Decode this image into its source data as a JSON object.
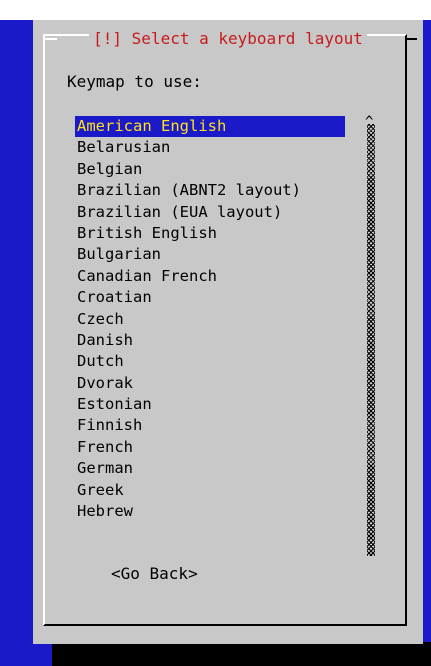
{
  "dialog": {
    "title": "[!] Select a keyboard layout",
    "prompt": "Keymap to use:",
    "scroll_arrow": "^",
    "go_back_label": "<Go Back>"
  },
  "keymaps": [
    "American English",
    "Belarusian",
    "Belgian",
    "Brazilian (ABNT2 layout)",
    "Brazilian (EUA layout)",
    "British English",
    "Bulgarian",
    "Canadian French",
    "Croatian",
    "Czech",
    "Danish",
    "Dutch",
    "Dvorak",
    "Estonian",
    "Finnish",
    "French",
    "German",
    "Greek",
    "Hebrew"
  ],
  "selected_keymap": "American English",
  "colors": {
    "screen_background": "#1a1ac8",
    "dialog_background": "#c8c8c8",
    "title_text": "#c81a1a",
    "selection_background": "#1a1ac8",
    "selection_text": "#ffe01a"
  }
}
